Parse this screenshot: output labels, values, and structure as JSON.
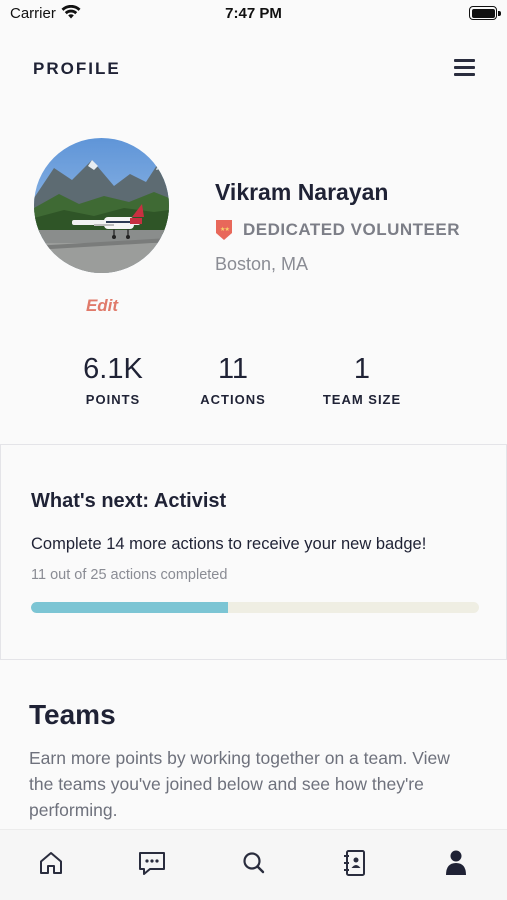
{
  "status_bar": {
    "carrier": "Carrier",
    "time": "7:47 PM"
  },
  "header": {
    "title": "PROFILE",
    "menu_icon": "hamburger-menu-icon"
  },
  "profile": {
    "name": "Vikram Narayan",
    "badge": "DEDICATED VOLUNTEER",
    "badge_color": "#e8685a",
    "location": "Boston, MA",
    "edit_label": "Edit"
  },
  "stats": [
    {
      "value": "6.1K",
      "label": "POINTS"
    },
    {
      "value": "11",
      "label": "ACTIONS"
    },
    {
      "value": "1",
      "label": "TEAM SIZE"
    }
  ],
  "next": {
    "title": "What's next: Activist",
    "description": "Complete 14 more actions to receive your new badge!",
    "progress_text": "11 out of 25 actions completed",
    "progress_completed": 11,
    "progress_total": 25,
    "progress_color": "#7cc5d4"
  },
  "teams": {
    "title": "Teams",
    "description": "Earn more points by working together on a team. View the teams you've joined below and see how they're performing."
  },
  "tabbar": {
    "items": [
      {
        "icon": "home-icon",
        "active": false
      },
      {
        "icon": "chat-icon",
        "active": false
      },
      {
        "icon": "search-icon",
        "active": false
      },
      {
        "icon": "contacts-book-icon",
        "active": false
      },
      {
        "icon": "profile-icon",
        "active": true
      }
    ]
  }
}
